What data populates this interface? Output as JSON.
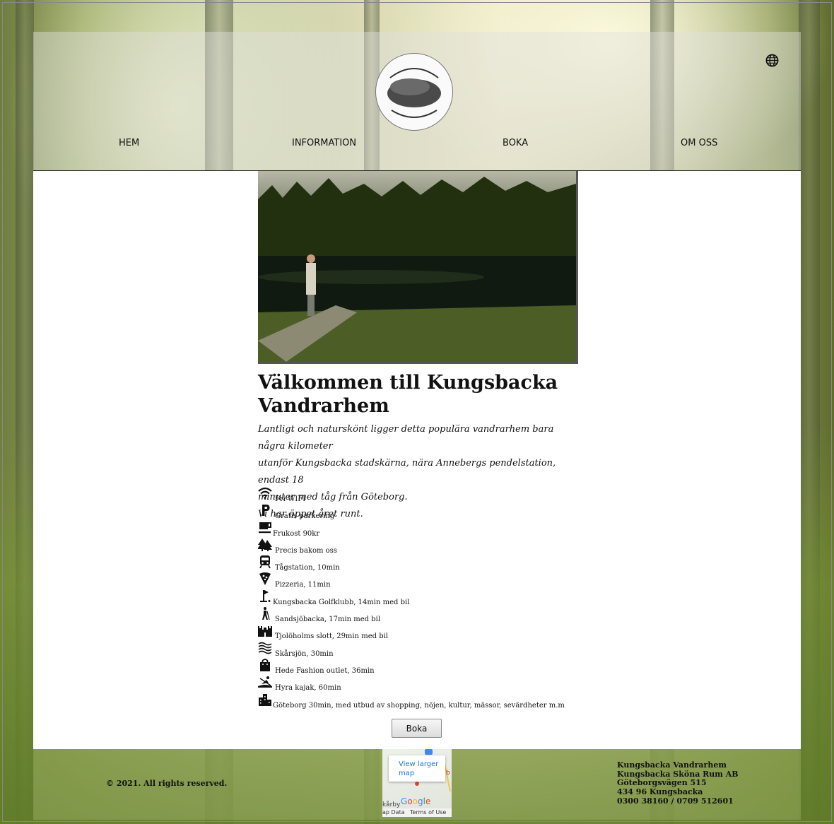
{
  "header": {
    "logo_alt": "Kungsbacka Vandrarhem",
    "nav": [
      {
        "label": "HEM"
      },
      {
        "label": "INFORMATION"
      },
      {
        "label": "BOKA"
      },
      {
        "label": "OM OSS"
      }
    ],
    "language_icon": "globe-icon"
  },
  "main": {
    "welcome_title": "Välkommen till Kungsbacka Vandrarhem",
    "intro_lines": [
      "Lantligt och naturskönt ligger detta populära vandrarhem bara några kilometer",
      "utanför Kungsbacka stadskärna, nära Annebergs pendelstation, endast 18",
      "minuter med tåg från Göteborg.",
      "Vi har öppet året runt."
    ],
    "amenities": [
      {
        "icon": "wifi-icon",
        "text": "Fri WIFI"
      },
      {
        "icon": "parking-icon",
        "text": "Gratis parkering"
      },
      {
        "icon": "coffee-icon",
        "text": "Frukost 90kr"
      },
      {
        "icon": "forest-icon",
        "text": "Precis bakom oss"
      },
      {
        "icon": "train-icon",
        "text": "Tågstation, 10min"
      },
      {
        "icon": "pizza-icon",
        "text": "Pizzeria, 11min"
      },
      {
        "icon": "golf-icon",
        "text": "Kungsbacka Golfklubb, 14min med bil"
      },
      {
        "icon": "hiking-icon",
        "text": "Sandsjöbacka, 17min med bil"
      },
      {
        "icon": "castle-icon",
        "text": "Tjolöholms slott, 29min med bil"
      },
      {
        "icon": "waves-icon",
        "text": "Skårsjön, 30min"
      },
      {
        "icon": "shopping-bag-icon",
        "text": "Hede Fashion outlet, 36min"
      },
      {
        "icon": "kayak-icon",
        "text": "Hyra kajak, 60min"
      },
      {
        "icon": "city-icon",
        "text": "Göteborg 30min, med utbud av shopping, nöjen, kultur, mässor, sevärdheter m.m"
      }
    ],
    "book_button": "Boka"
  },
  "footer": {
    "copyright": "© 2021. All rights reserved.",
    "map": {
      "larger_map": "View larger map",
      "google": "Google",
      "place_fragment": "kårby",
      "map_data": "ap Data",
      "terms": "Terms of Use"
    },
    "address": [
      "Kungsbacka Vandrarhem",
      "Kungsbacka Sköna Rum AB",
      "Göteborgsvägen 515",
      "434 96 Kungsbacka",
      "0300 38160 / 0709 512601"
    ]
  }
}
